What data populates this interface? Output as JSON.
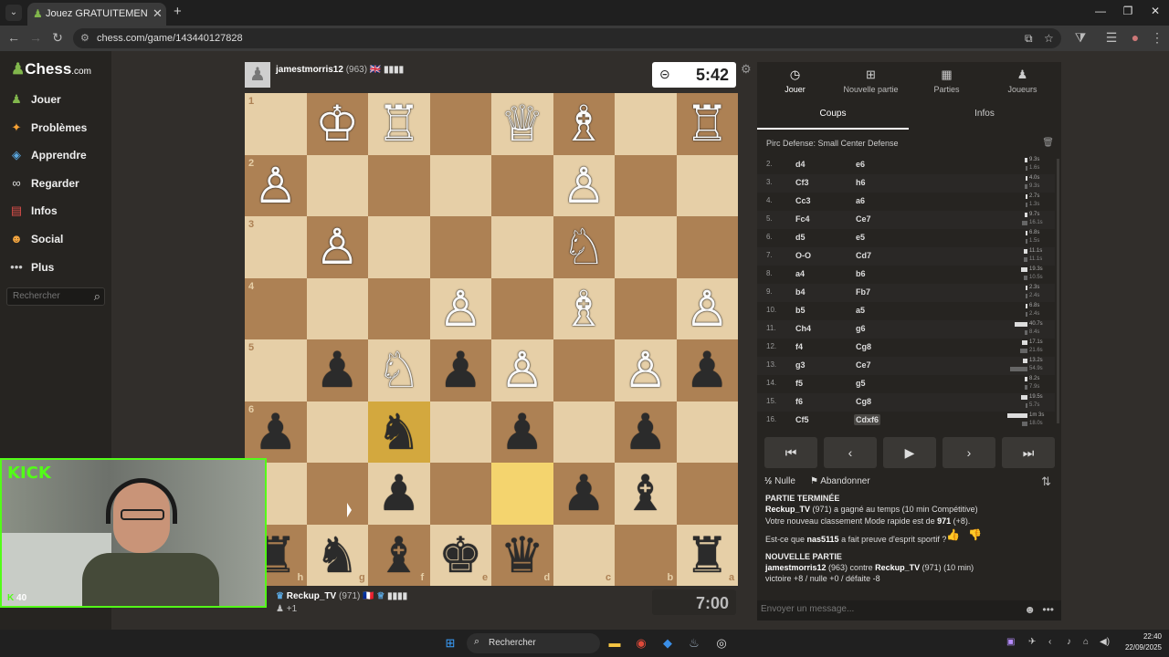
{
  "browser": {
    "tab_title": "Jouez GRATUITEMENT aux échecs",
    "url": "chess.com/game/143440127828"
  },
  "sidebar": {
    "logo": "Chess",
    "logo_suffix": ".com",
    "items": [
      {
        "label": "Jouer",
        "icon": "play-pawn-icon",
        "color": "#81b64c"
      },
      {
        "label": "Problèmes",
        "icon": "puzzle-icon",
        "color": "#f7a234"
      },
      {
        "label": "Apprendre",
        "icon": "learn-cap-icon",
        "color": "#5aa7e0"
      },
      {
        "label": "Regarder",
        "icon": "binoculars-icon",
        "color": "#dddddd"
      },
      {
        "label": "Infos",
        "icon": "news-icon",
        "color": "#e2504c"
      },
      {
        "label": "Social",
        "icon": "social-icon",
        "color": "#f4a640"
      },
      {
        "label": "Plus",
        "icon": "more-dots-icon",
        "color": "#cccccc"
      }
    ],
    "search_placeholder": "Rechercher"
  },
  "top_player": {
    "name": "jamestmorris12",
    "rating": "(963)",
    "flag": "🇬🇧",
    "clock": "5:42"
  },
  "bottom_player": {
    "name": "Reckup_TV",
    "rating": "(971)",
    "flag": "🇫🇷",
    "extra": "+1",
    "clock": "7:00"
  },
  "board": {
    "orientation": "black-bottom",
    "ranks_left": [
      "1",
      "2",
      "3",
      "4",
      "5",
      "6",
      "7",
      "8"
    ],
    "files_bottom": [
      "h",
      "g",
      "f",
      "e",
      "d",
      "c",
      "b",
      "a"
    ],
    "pieces": [
      {
        "r": 0,
        "c": 1,
        "p": "♔",
        "side": "w"
      },
      {
        "r": 0,
        "c": 2,
        "p": "♖",
        "side": "w"
      },
      {
        "r": 0,
        "c": 4,
        "p": "♕",
        "side": "w"
      },
      {
        "r": 0,
        "c": 5,
        "p": "♗",
        "side": "w"
      },
      {
        "r": 0,
        "c": 7,
        "p": "♖",
        "side": "w"
      },
      {
        "r": 1,
        "c": 0,
        "p": "♙",
        "side": "w"
      },
      {
        "r": 1,
        "c": 5,
        "p": "♙",
        "side": "w"
      },
      {
        "r": 2,
        "c": 1,
        "p": "♙",
        "side": "w"
      },
      {
        "r": 2,
        "c": 5,
        "p": "♘",
        "side": "w"
      },
      {
        "r": 3,
        "c": 3,
        "p": "♙",
        "side": "w"
      },
      {
        "r": 3,
        "c": 5,
        "p": "♗",
        "side": "w"
      },
      {
        "r": 3,
        "c": 7,
        "p": "♙",
        "side": "w"
      },
      {
        "r": 4,
        "c": 1,
        "p": "♟",
        "side": "b"
      },
      {
        "r": 4,
        "c": 2,
        "p": "♘",
        "side": "w"
      },
      {
        "r": 4,
        "c": 3,
        "p": "♟",
        "side": "b"
      },
      {
        "r": 4,
        "c": 4,
        "p": "♙",
        "side": "w"
      },
      {
        "r": 4,
        "c": 6,
        "p": "♙",
        "side": "w"
      },
      {
        "r": 4,
        "c": 7,
        "p": "♟",
        "side": "b"
      },
      {
        "r": 5,
        "c": 0,
        "p": "♟",
        "side": "b"
      },
      {
        "r": 5,
        "c": 2,
        "p": "♞",
        "side": "b"
      },
      {
        "r": 5,
        "c": 4,
        "p": "♟",
        "side": "b"
      },
      {
        "r": 5,
        "c": 6,
        "p": "♟",
        "side": "b"
      },
      {
        "r": 6,
        "c": 2,
        "p": "♟",
        "side": "b"
      },
      {
        "r": 6,
        "c": 5,
        "p": "♟",
        "side": "b"
      },
      {
        "r": 6,
        "c": 6,
        "p": "♝",
        "side": "b"
      },
      {
        "r": 7,
        "c": 0,
        "p": "♜",
        "side": "b"
      },
      {
        "r": 7,
        "c": 1,
        "p": "♞",
        "side": "b"
      },
      {
        "r": 7,
        "c": 2,
        "p": "♝",
        "side": "b"
      },
      {
        "r": 7,
        "c": 3,
        "p": "♚",
        "side": "b"
      },
      {
        "r": 7,
        "c": 4,
        "p": "♛",
        "side": "b"
      },
      {
        "r": 7,
        "c": 7,
        "p": "♜",
        "side": "b"
      }
    ],
    "highlights": [
      {
        "r": 5,
        "c": 2
      },
      {
        "r": 6,
        "c": 4
      }
    ]
  },
  "panel": {
    "tabs": [
      {
        "label": "Jouer",
        "icon": "stopwatch-icon"
      },
      {
        "label": "Nouvelle partie",
        "icon": "plus-square-icon"
      },
      {
        "label": "Parties",
        "icon": "board-icon"
      },
      {
        "label": "Joueurs",
        "icon": "players-icon"
      }
    ],
    "subtabs": [
      "Coups",
      "Infos"
    ],
    "opening": "Pirc Defense: Small Center Defense",
    "moves": [
      {
        "n": "2.",
        "w": "d4",
        "b": "e6",
        "tw": "9.3s",
        "tb": "1.6s",
        "fw": 0.08,
        "fb": 0.02
      },
      {
        "n": "3.",
        "w": "Cf3",
        "b": "h6",
        "tw": "4.0s",
        "tb": "9.3s",
        "fw": 0.04,
        "fb": 0.08
      },
      {
        "n": "4.",
        "w": "Cc3",
        "b": "a6",
        "tw": "2.7s",
        "tb": "1.3s",
        "fw": 0.03,
        "fb": 0.02
      },
      {
        "n": "5.",
        "w": "Fc4",
        "b": "Ce7",
        "tw": "9.7s",
        "tb": "16.1s",
        "fw": 0.08,
        "fb": 0.14
      },
      {
        "n": "6.",
        "w": "d5",
        "b": "e5",
        "tw": "6.8s",
        "tb": "1.5s",
        "fw": 0.06,
        "fb": 0.02
      },
      {
        "n": "7.",
        "w": "O-O",
        "b": "Cd7",
        "tw": "11.1s",
        "tb": "11.1s",
        "fw": 0.1,
        "fb": 0.1
      },
      {
        "n": "8.",
        "w": "a4",
        "b": "b6",
        "tw": "19.3s",
        "tb": "10.5s",
        "fw": 0.17,
        "fb": 0.09
      },
      {
        "n": "9.",
        "w": "b4",
        "b": "Fb7",
        "tw": "2.3s",
        "tb": "2.4s",
        "fw": 0.02,
        "fb": 0.02
      },
      {
        "n": "10.",
        "w": "b5",
        "b": "a5",
        "tw": "6.8s",
        "tb": "2.4s",
        "fw": 0.06,
        "fb": 0.02
      },
      {
        "n": "11.",
        "w": "Ch4",
        "b": "g6",
        "tw": "40.7s",
        "tb": "8.4s",
        "fw": 0.36,
        "fb": 0.07
      },
      {
        "n": "12.",
        "w": "f4",
        "b": "Cg8",
        "tw": "17.1s",
        "tb": "21.6s",
        "fw": 0.15,
        "fb": 0.19
      },
      {
        "n": "13.",
        "w": "g3",
        "b": "Ce7",
        "tw": "13.2s",
        "tb": "54.9s",
        "fw": 0.12,
        "fb": 0.48
      },
      {
        "n": "14.",
        "w": "f5",
        "b": "g5",
        "tw": "8.2s",
        "tb": "7.9s",
        "fw": 0.07,
        "fb": 0.07
      },
      {
        "n": "15.",
        "w": "f6",
        "b": "Cg8",
        "tw": "19.5s",
        "tb": "5.7s",
        "fw": 0.17,
        "fb": 0.05
      },
      {
        "n": "16.",
        "w": "Cf5",
        "b": "Cdxf6",
        "tw": "1m 3s",
        "tb": "18.0s",
        "fw": 0.55,
        "fb": 0.16
      }
    ],
    "draw_label": "Nulle",
    "draw_icon_text": "½",
    "resign_label": "Abandonner",
    "log": {
      "header1": "PARTIE TERMINÉE",
      "result_name": "Reckup_TV",
      "result_text": " (971) a gagné au temps (10 min Compétitive)",
      "rating_text_a": "Votre nouveau classement Mode rapide est de ",
      "rating_value": "971",
      "rating_text_b": " (+8).",
      "sport_a": "Est-ce que ",
      "sport_name": "nas5115",
      "sport_b": " a fait preuve d'esprit sportif ?",
      "header2": "NOUVELLE PARTIE",
      "new_p1": "jamestmorris12",
      "new_mid": " (963) contre ",
      "new_p2": "Reckup_TV",
      "new_end": " (971) (10 min)",
      "stakes": "victoire +8 / nulle +0 / défaite -8"
    },
    "message_placeholder": "Envoyer un message..."
  },
  "webcam": {
    "brand": "KICK",
    "viewers": "40",
    "brand_color": "#53fc18"
  },
  "taskbar": {
    "search_label": "Rechercher",
    "time": "22:40",
    "date": "22/09/2025"
  }
}
